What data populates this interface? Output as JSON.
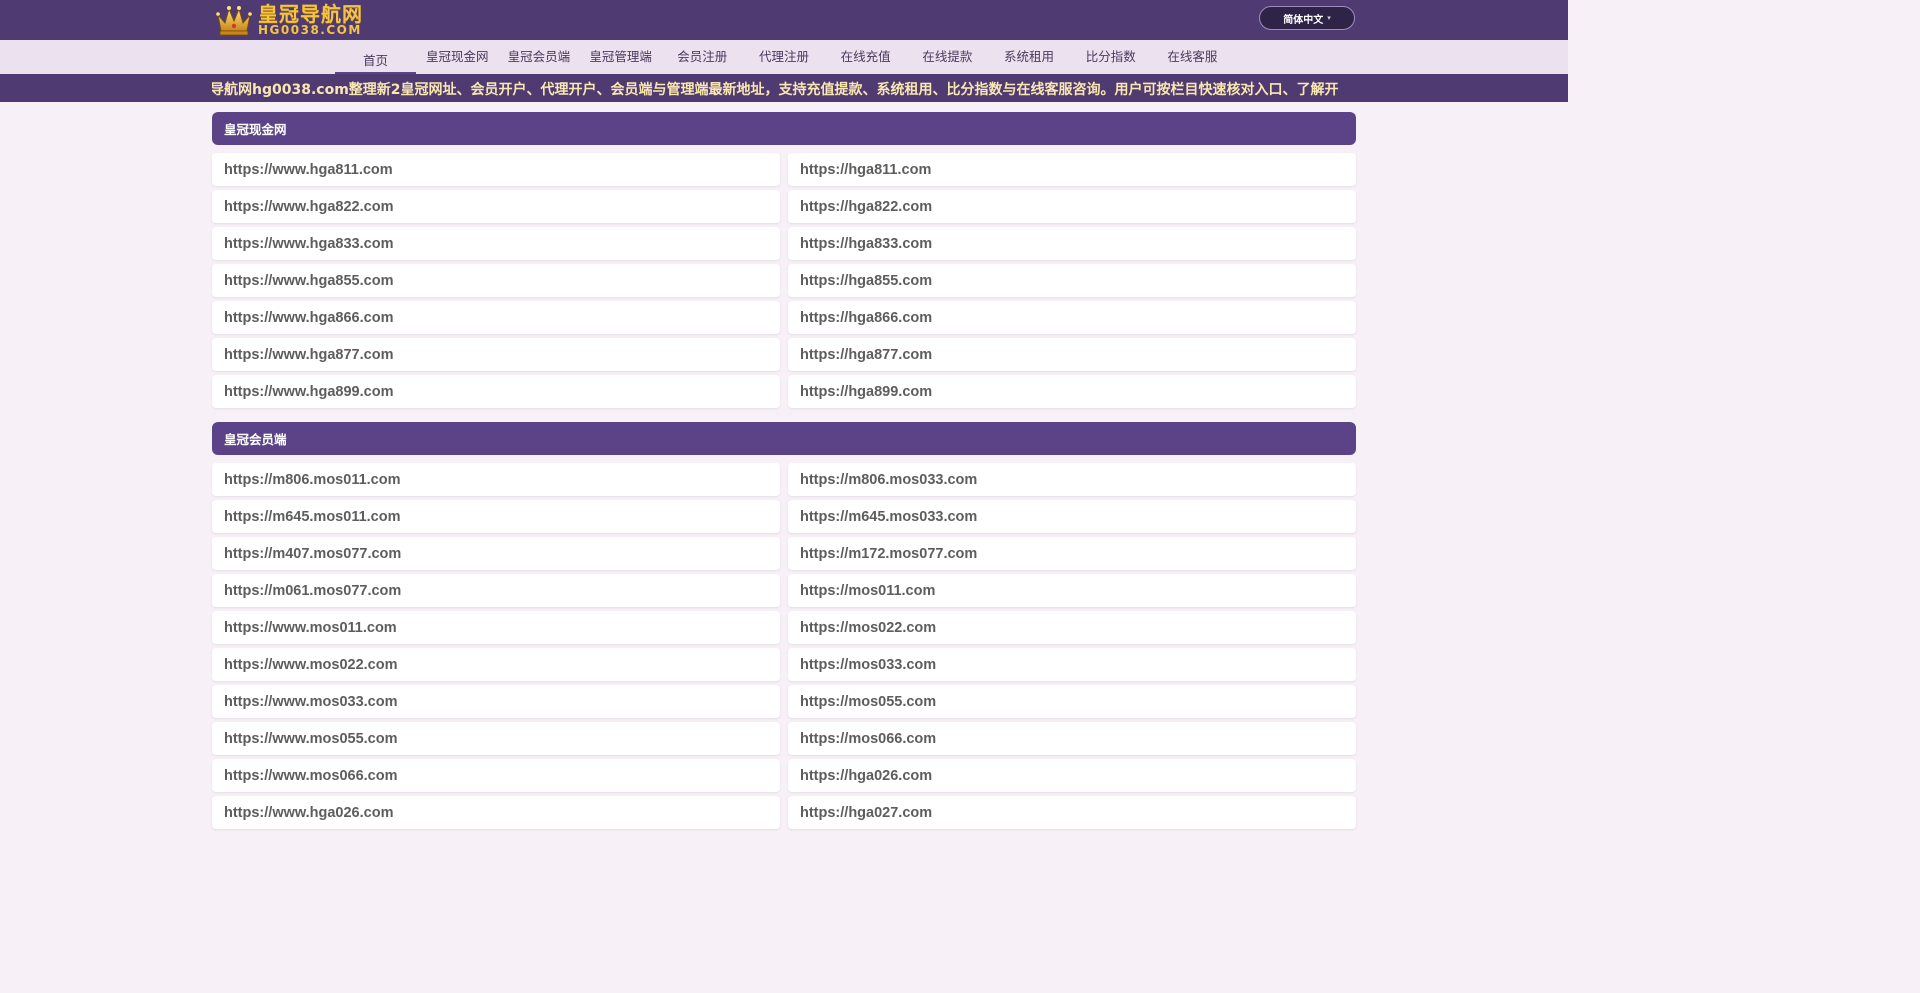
{
  "header": {
    "logo_cn": "皇冠导航网",
    "logo_en": "HG0038.COM",
    "lang_label": "简体中文"
  },
  "nav": {
    "items": [
      "首页",
      "皇冠现金网",
      "皇冠会员端",
      "皇冠管理端",
      "会员注册",
      "代理注册",
      "在线充值",
      "在线提款",
      "系统租用",
      "比分指数",
      "在线客服"
    ]
  },
  "ticker": {
    "text": "皇冠导航网hg0038.com整理新2皇冠网址、会员开户、代理开户、会员端与管理端最新地址，支持充值提款、系统租用、比分指数与在线客服咨询。用户可按栏目快速核对入口、了解开"
  },
  "sections": [
    {
      "title": "皇冠现金网",
      "links": [
        "https://www.hga811.com",
        "https://hga811.com",
        "https://www.hga822.com",
        "https://hga822.com",
        "https://www.hga833.com",
        "https://hga833.com",
        "https://www.hga855.com",
        "https://hga855.com",
        "https://www.hga866.com",
        "https://hga866.com",
        "https://www.hga877.com",
        "https://hga877.com",
        "https://www.hga899.com",
        "https://hga899.com"
      ]
    },
    {
      "title": "皇冠会员端",
      "links": [
        "https://m806.mos011.com",
        "https://m806.mos033.com",
        "https://m645.mos011.com",
        "https://m645.mos033.com",
        "https://m407.mos077.com",
        "https://m172.mos077.com",
        "https://m061.mos077.com",
        "https://mos011.com",
        "https://www.mos011.com",
        "https://mos022.com",
        "https://www.mos022.com",
        "https://mos033.com",
        "https://www.mos033.com",
        "https://mos055.com",
        "https://www.mos055.com",
        "https://mos066.com",
        "https://www.mos066.com",
        "https://hga026.com",
        "https://www.hga026.com",
        "https://hga027.com"
      ]
    }
  ]
}
